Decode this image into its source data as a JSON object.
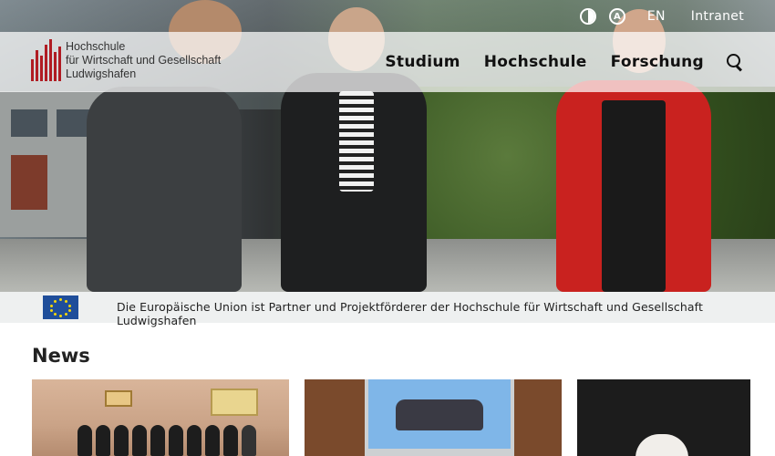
{
  "utility": {
    "contrast_icon": "contrast-icon",
    "text_icon": "text-icon",
    "language": "EN",
    "intranet": "Intranet"
  },
  "header": {
    "logo_lines": [
      "Hochschule",
      "für Wirtschaft und Gesellschaft",
      "Ludwigshafen"
    ],
    "logo_color": "#b01c23"
  },
  "nav": {
    "items": [
      "Studium",
      "Hochschule",
      "Forschung"
    ],
    "search_icon": "search-icon"
  },
  "eu_bar": {
    "text": "Die Europäische Union ist Partner und Projektförderer der Hochschule für Wirtschaft und Gesellschaft Ludwigshafen",
    "flag_color": "#1f4e9a"
  },
  "news": {
    "title": "News"
  }
}
